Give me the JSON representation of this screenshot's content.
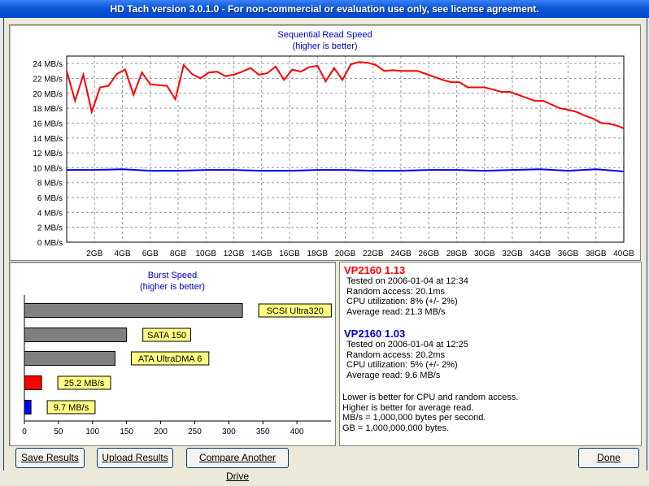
{
  "window": {
    "title": "HD Tach version 3.0.1.0  - For non-commercial or evaluation use only, see license agreement."
  },
  "seq": {
    "title": "Sequential Read Speed",
    "subtitle": "(higher is better)",
    "y_ticks": [
      "0 MB/s",
      "2 MB/s",
      "4 MB/s",
      "6 MB/s",
      "8 MB/s",
      "10 MB/s",
      "12 MB/s",
      "14 MB/s",
      "16 MB/s",
      "18 MB/s",
      "20 MB/s",
      "22 MB/s",
      "24 MB/s"
    ],
    "x_ticks": [
      "2GB",
      "4GB",
      "6GB",
      "8GB",
      "10GB",
      "12GB",
      "14GB",
      "16GB",
      "18GB",
      "20GB",
      "22GB",
      "24GB",
      "26GB",
      "28GB",
      "30GB",
      "32GB",
      "34GB",
      "36GB",
      "38GB",
      "40GB"
    ]
  },
  "burst": {
    "title": "Burst Speed",
    "subtitle": "(higher is better)",
    "x_ticks": [
      "0",
      "50",
      "100",
      "150",
      "200",
      "250",
      "300",
      "350",
      "400"
    ]
  },
  "chart_data": [
    {
      "type": "line",
      "title": "Sequential Read Speed",
      "subtitle": "(higher is better)",
      "xlim": [
        0,
        40
      ],
      "ylim": [
        0,
        25
      ],
      "grid": true,
      "series": [
        {
          "name": "VP2160 1.13",
          "color": "#ff0000",
          "x": [
            0,
            0.6,
            1.2,
            1.8,
            2.4,
            3,
            3.6,
            4.2,
            4.8,
            5.4,
            6,
            6.6,
            7.2,
            7.8,
            8.4,
            9,
            9.6,
            10.2,
            10.8,
            11.4,
            12,
            12.6,
            13.2,
            13.8,
            14.4,
            15,
            15.6,
            16.2,
            16.8,
            17.4,
            18,
            18.6,
            19.2,
            19.8,
            20.4,
            21,
            21.6,
            22.2,
            22.8,
            23.4,
            24,
            24.6,
            25.2,
            25.8,
            26.4,
            27,
            27.6,
            28.2,
            28.8,
            29.4,
            30,
            30.6,
            31.2,
            31.8,
            32.4,
            33,
            33.6,
            34.2,
            34.8,
            35.4,
            36,
            36.6,
            37.2,
            37.8,
            38.4,
            39,
            39.6,
            40
          ],
          "values": [
            23.0,
            19.0,
            22.5,
            17.5,
            20.8,
            21.0,
            22.6,
            23.2,
            19.8,
            22.8,
            21.2,
            21.1,
            21.0,
            19.2,
            23.8,
            22.6,
            22.0,
            22.8,
            22.9,
            22.3,
            22.5,
            22.9,
            23.4,
            22.5,
            22.7,
            23.6,
            21.8,
            23.2,
            22.9,
            23.5,
            23.7,
            21.6,
            23.4,
            21.8,
            23.9,
            24.2,
            24.1,
            23.8,
            23.0,
            23.1,
            23.0,
            23.0,
            23.0,
            22.6,
            22.2,
            21.8,
            21.5,
            21.5,
            20.8,
            20.8,
            20.8,
            20.5,
            20.2,
            20.2,
            19.8,
            19.4,
            19.0,
            19.0,
            18.5,
            18.0,
            17.8,
            17.5,
            17.0,
            16.6,
            16.0,
            15.9,
            15.6,
            15.3
          ]
        },
        {
          "name": "VP2160 1.03",
          "color": "#0000ff",
          "x": [
            0,
            2,
            4,
            6,
            8,
            10,
            12,
            14,
            16,
            18,
            20,
            22,
            24,
            26,
            28,
            30,
            32,
            34,
            36,
            38,
            40
          ],
          "values": [
            9.7,
            9.7,
            9.8,
            9.6,
            9.6,
            9.7,
            9.7,
            9.6,
            9.6,
            9.7,
            9.7,
            9.6,
            9.6,
            9.7,
            9.7,
            9.6,
            9.7,
            9.8,
            9.6,
            9.8,
            9.5
          ]
        }
      ]
    },
    {
      "type": "bar",
      "orientation": "horizontal",
      "title": "Burst Speed",
      "subtitle": "(higher is better)",
      "xlim": [
        0,
        450
      ],
      "categories": [
        "SCSI Ultra320",
        "SATA 150",
        "ATA UltraDMA 6",
        "25.2 MB/s",
        "9.7 MB/s"
      ],
      "values": [
        320,
        150,
        133,
        25.2,
        9.7
      ],
      "colors": [
        "#808080",
        "#808080",
        "#808080",
        "#ff0000",
        "#0000ff"
      ]
    }
  ],
  "drive1": {
    "name": "VP2160 1.13",
    "tested": "Tested on 2006-01-04 at 12:34",
    "random": "Random access: 20.1ms",
    "cpu": "CPU utilization: 8% (+/- 2%)",
    "avg": "Average read: 21.3 MB/s"
  },
  "drive2": {
    "name": "VP2160 1.03",
    "tested": "Tested on 2006-01-04 at 12:25",
    "random": "Random access: 20.2ms",
    "cpu": "CPU utilization: 5% (+/- 2%)",
    "avg": "Average read: 9.6 MB/s"
  },
  "notes": [
    "Lower is better for CPU and random access.",
    "Higher is better for average read.",
    "MB/s = 1,000,000 bytes per second.",
    "GB = 1,000,000,000 bytes."
  ],
  "buttons": {
    "save": "Save Results",
    "upload": "Upload Results",
    "compare": "Compare Another Drive",
    "done": "Done"
  }
}
